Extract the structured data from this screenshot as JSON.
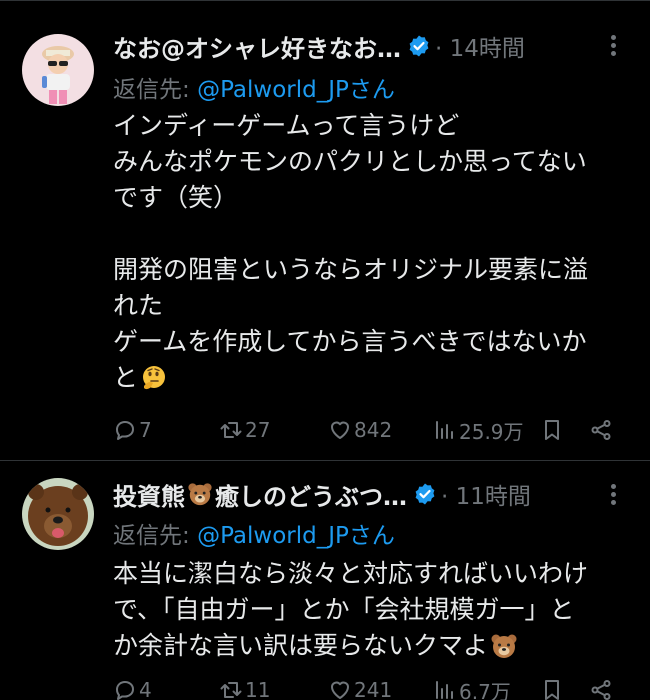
{
  "tweets": [
    {
      "author_name": "なお@オシャレ好きなお…",
      "time": "· 14時間",
      "reply_prefix": "返信先: ",
      "reply_handle": "@Palworld_JPさん",
      "lines": [
        "インディーゲームって言うけど",
        "みんなポケモンのパクリとしか思ってない",
        "です（笑）",
        "",
        "開発の阻害というならオリジナル要素に溢",
        "れた",
        "ゲームを作成してから言うべきではないか",
        "と"
      ],
      "emoji": "thinking-face",
      "stats": {
        "replies": "7",
        "retweets": "27",
        "likes": "842",
        "views": "25.9万"
      }
    },
    {
      "author_name": "投資熊",
      "author_name_suffix": "癒しのどうぶつ…",
      "time": "· 11時間",
      "reply_prefix": "返信先: ",
      "reply_handle": "@Palworld_JPさん",
      "lines": [
        "本当に潔白なら淡々と対応すればいいわけ",
        "で、「自由ガー」とか「会社規模ガ一」と",
        "か余計な言い訳は要らないクマよ"
      ],
      "emoji": "bear-face",
      "stats": {
        "replies": "4",
        "retweets": "11",
        "likes": "241",
        "views": "6.7万"
      }
    }
  ],
  "colors": {
    "background": "#000000",
    "text": "#e7e9ea",
    "muted": "#71767b",
    "link": "#1d9bf0",
    "divider": "#2f3336"
  }
}
